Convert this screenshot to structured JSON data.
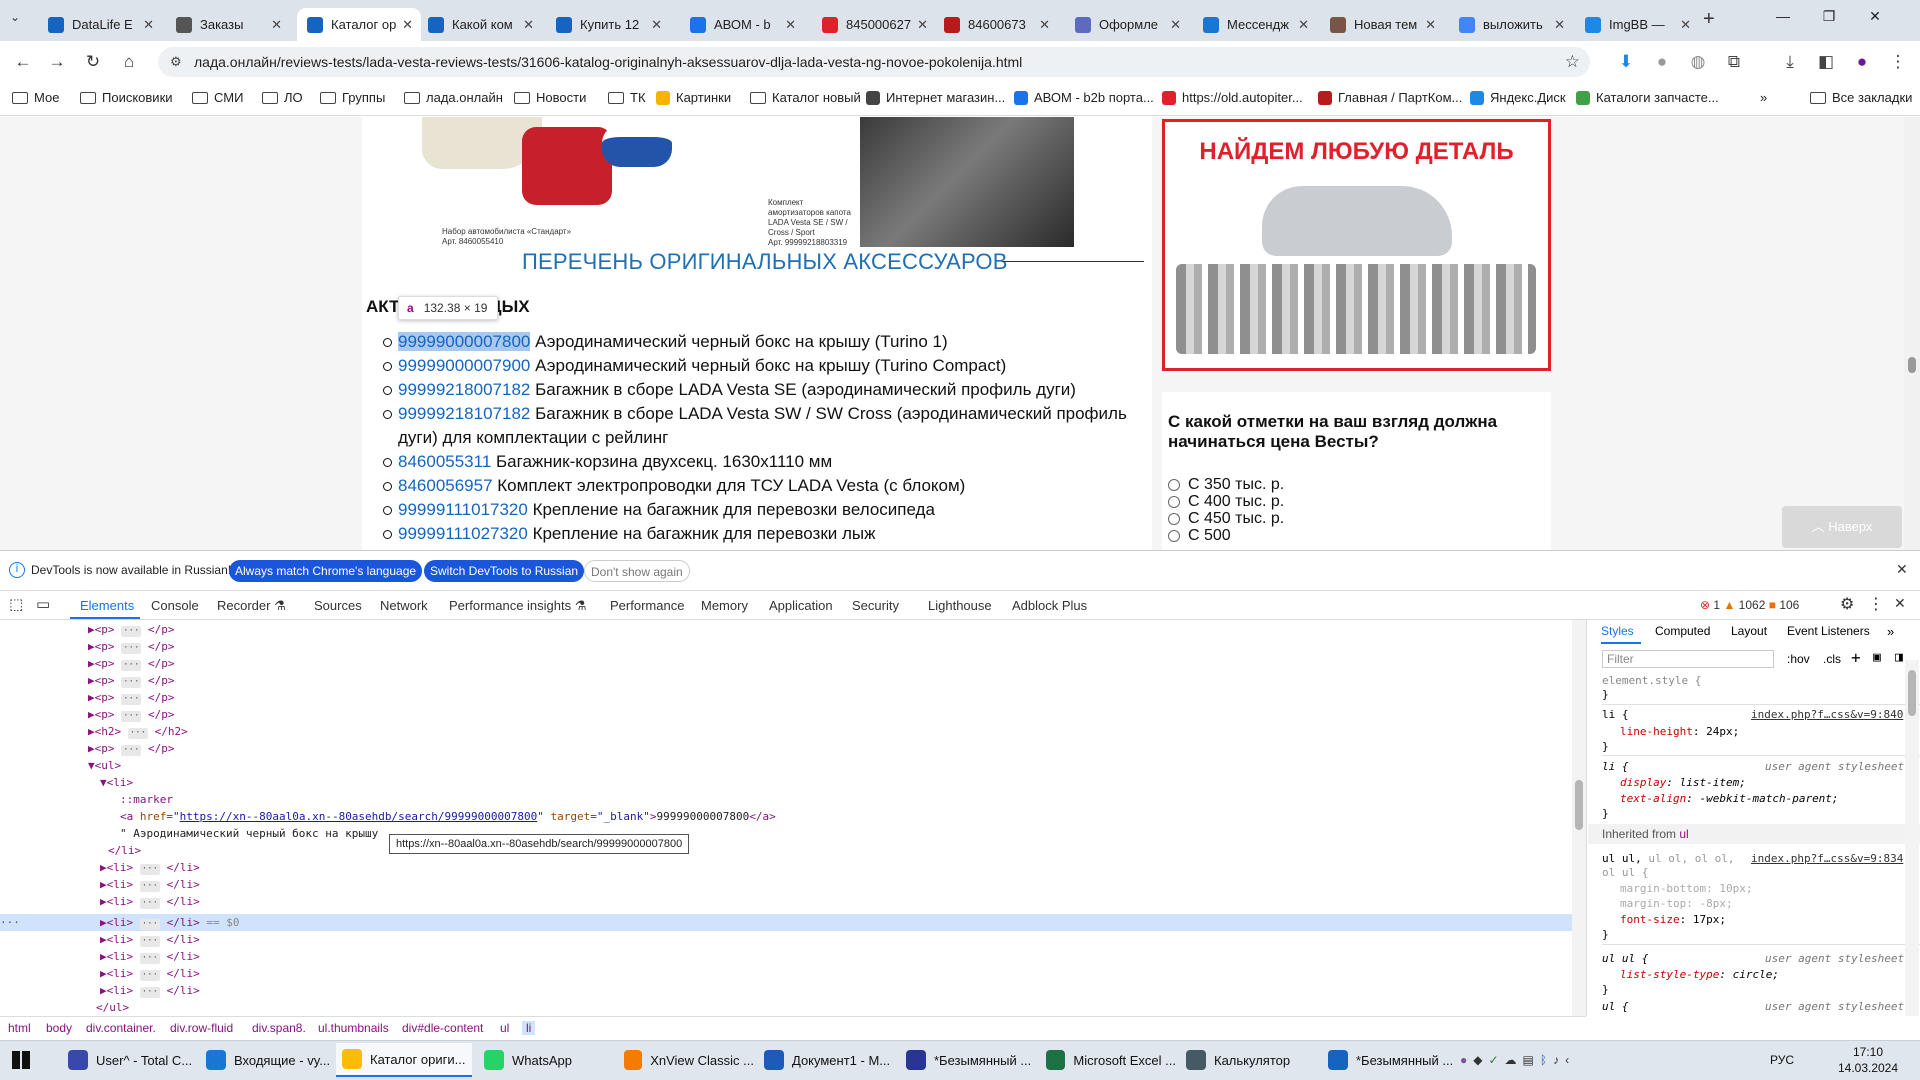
{
  "tabs": [
    {
      "title": "DataLife E",
      "color": "#1565c0"
    },
    {
      "title": "Заказы",
      "color": "#555"
    },
    {
      "title": "Каталог ор",
      "color": "#1565c0",
      "active": true
    },
    {
      "title": "Какой ком",
      "color": "#1565c0"
    },
    {
      "title": "Купить 12",
      "color": "#1565c0"
    },
    {
      "title": "АВОМ - b",
      "color": "#1a73e8"
    },
    {
      "title": "845000627",
      "color": "#e0212b"
    },
    {
      "title": "84600673",
      "color": "#b71c1c"
    },
    {
      "title": "Оформле",
      "color": "#5c6bc0"
    },
    {
      "title": "Мессендж",
      "color": "#1976d2"
    },
    {
      "title": "Новая тем",
      "color": "#795548"
    },
    {
      "title": "выложить",
      "color": "#4285f4"
    },
    {
      "title": "ImgBB —",
      "color": "#1e88e5"
    }
  ],
  "url": "лада.онлайн/reviews-tests/lada-vesta-reviews-tests/31606-katalog-originalnyh-aksessuarov-dlja-lada-vesta-ng-novoe-pokolenija.html",
  "bookmarks": [
    {
      "label": "Мое",
      "type": "folder"
    },
    {
      "label": "Поисковики",
      "type": "folder"
    },
    {
      "label": "СМИ",
      "type": "folder"
    },
    {
      "label": "ЛО",
      "type": "folder"
    },
    {
      "label": "Группы",
      "type": "folder"
    },
    {
      "label": "лада.онлайн",
      "type": "folder"
    },
    {
      "label": "Новости",
      "type": "folder"
    },
    {
      "label": "ТК",
      "type": "folder"
    },
    {
      "label": "Картинки",
      "type": "site",
      "color": "#f4b400"
    },
    {
      "label": "Каталог новый",
      "type": "folder"
    },
    {
      "label": "Интернет магазин...",
      "type": "site",
      "color": "#444"
    },
    {
      "label": "АВОМ - b2b порта...",
      "type": "site",
      "color": "#1a73e8"
    },
    {
      "label": "https://old.autopiter...",
      "type": "site",
      "color": "#e0212b"
    },
    {
      "label": "Главная / ПартКом...",
      "type": "site",
      "color": "#b71c1c"
    },
    {
      "label": "Яндекс.Диск",
      "type": "site",
      "color": "#1e88e5"
    },
    {
      "label": "Каталоги запчасте...",
      "type": "site",
      "color": "#43a047"
    }
  ],
  "all_bookmarks": "Все закладки",
  "page": {
    "img_caption_left": "Набор автомобилиста «Стандарт»\nАрт. 8460055410",
    "img_caption_right": "Комплект\nамортизаторов капота\nLADA Vesta SE / SW /\nCross / Sport\nАрт. 99999218803319",
    "heading": "ПЕРЕЧЕНЬ ОРИГИНАЛЬНЫХ АКСЕССУАРОВ",
    "subheading": "АКТ",
    "subheading_tail": "ДЫХ",
    "tooltip_tag": "a",
    "tooltip_size": "132.38 × 19",
    "items": [
      {
        "code": "99999000007800",
        "text": " Аэродинамический черный бокс на крышу (Turino 1)"
      },
      {
        "code": "99999000007900",
        "text": " Аэродинамический черный бокс на крышу (Turino Compact)"
      },
      {
        "code": "99999218007182",
        "text": " Багажник в сборе LADA Vesta SE (аэродинамический профиль дуги)"
      },
      {
        "code": "99999218107182",
        "text": " Багажник в сборе LADA Vesta SW / SW Cross (аэродинамический профиль дуги) для комплектации с рейлинг"
      },
      {
        "code": "8460055311",
        "text": " Багажник-корзина двухсекц. 1630х1110 мм"
      },
      {
        "code": "8460056957",
        "text": " Комплект электропроводки для ТСУ LADA Vesta (с блоком)"
      },
      {
        "code": "99999111017320",
        "text": " Крепление на багажник для перевозки велосипеда"
      },
      {
        "code": "99999111027320",
        "text": " Крепление на багажник для перевозки лыж"
      }
    ],
    "ad_title": "НАЙДЕМ ЛЮБУЮ ДЕТАЛЬ",
    "poll_question": "С какой отметки на ваш взгляд должна начинаться цена Весты?",
    "poll_options": [
      "С 350 тыс. р.",
      "С 400 тыс. р.",
      "С 450 тыс. р.",
      "С 500"
    ],
    "up_button": "Наверх"
  },
  "infobar": {
    "text": "DevTools is now available in Russian!",
    "btn1": "Always match Chrome's language",
    "btn2": "Switch DevTools to Russian",
    "btn3": "Don't show again"
  },
  "devtools_tabs": [
    "Elements",
    "Console",
    "Recorder ⚗",
    "Sources",
    "Network",
    "Performance insights ⚗",
    "Performance",
    "Memory",
    "Application",
    "Security",
    "Lighthouse",
    "Adblock Plus"
  ],
  "counts": {
    "errors": "1",
    "warnings": "1062",
    "info": "106"
  },
  "dom": {
    "href": "https://xn--80aal0a.xn--80asehdb/search/99999000007800",
    "target": "_blank",
    "link_text": "99999000007800",
    "text_node": "\" Аэродинамический черный бокс на крышу",
    "hover_url": "https://xn--80aal0a.xn--80asehdb/search/99999000007800",
    "selected_suffix": "== $0"
  },
  "styles_tabs": [
    "Styles",
    "Computed",
    "Layout",
    "Event Listeners"
  ],
  "styles": {
    "filter_placeholder": "Filter",
    "hov": ":hov",
    "cls": ".cls",
    "element_style": "element.style {",
    "src1": "index.php?f…css&v=9:840",
    "ua": "user agent stylesheet",
    "inherited": "Inherited from ",
    "inherited_tag": "ul",
    "src2": "index.php?f…css&v=9:834"
  },
  "breadcrumbs": [
    "html",
    "body",
    "div.container.",
    "div.row-fluid",
    "div.span8.",
    "ul.thumbnails",
    "div#dle-content",
    "ul",
    "li"
  ],
  "taskbar": [
    {
      "label": "User^ - Total C...",
      "color": "#3949ab"
    },
    {
      "label": "Входящие - vy...",
      "color": "#1976d2"
    },
    {
      "label": "Каталог ориги...",
      "color": "#fbbc04",
      "active": true
    },
    {
      "label": "WhatsApp",
      "color": "#25d366"
    },
    {
      "label": "XnView Classic ...",
      "color": "#f57c00"
    },
    {
      "label": "Документ1 - M...",
      "color": "#1e5bb8"
    },
    {
      "label": "*Безымянный ...",
      "color": "#283593"
    },
    {
      "label": "Microsoft Excel ...",
      "color": "#1e7145"
    },
    {
      "label": "Калькулятор",
      "color": "#455a64"
    },
    {
      "label": "*Безымянный ...",
      "color": "#1565c0"
    }
  ],
  "clock": {
    "time": "17:10",
    "date": "14.03.2024",
    "lang": "РУС"
  }
}
